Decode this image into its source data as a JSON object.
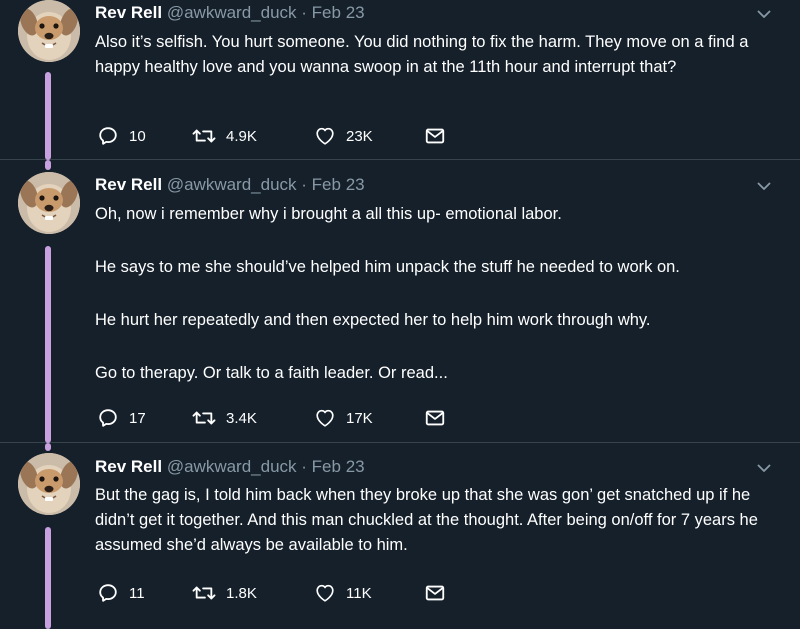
{
  "colors": {
    "background": "#15202b",
    "divider": "#38444d",
    "secondary_text": "#8899a6",
    "thread_line": "#c8a0e0"
  },
  "tweets": [
    {
      "name": "Rev Rell",
      "handle": "@awkward_duck",
      "separator": "·",
      "date": "Feb 23",
      "paragraphs": [
        "Also it’s selfish. You hurt someone. You did nothing to fix the harm. They move on a find a happy healthy love and you wanna swoop in at the 11th hour and interrupt that?"
      ],
      "replies": "10",
      "retweets": "4.9K",
      "likes": "23K",
      "icons": [
        "reply-icon",
        "retweet-icon",
        "like-icon",
        "message-icon",
        "chevron-down-icon"
      ]
    },
    {
      "name": "Rev Rell",
      "handle": "@awkward_duck",
      "separator": "·",
      "date": "Feb 23",
      "paragraphs": [
        "Oh, now i remember why i brought a all this up- emotional labor.",
        "He says to me she should’ve helped him unpack the stuff he needed to work on.",
        "He hurt her repeatedly and then expected her to help him work through why.",
        "Go to therapy. Or talk to a faith leader. Or read..."
      ],
      "replies": "17",
      "retweets": "3.4K",
      "likes": "17K"
    },
    {
      "name": "Rev Rell",
      "handle": "@awkward_duck",
      "separator": "·",
      "date": "Feb 23",
      "paragraphs": [
        "But the gag is, I told him back when they broke up that she was gon’ get snatched up if he didn’t get it together. And this man chuckled at the thought. After being on/off for 7 years he assumed she’d always be available to him."
      ],
      "replies": "11",
      "retweets": "1.8K",
      "likes": "11K"
    }
  ]
}
